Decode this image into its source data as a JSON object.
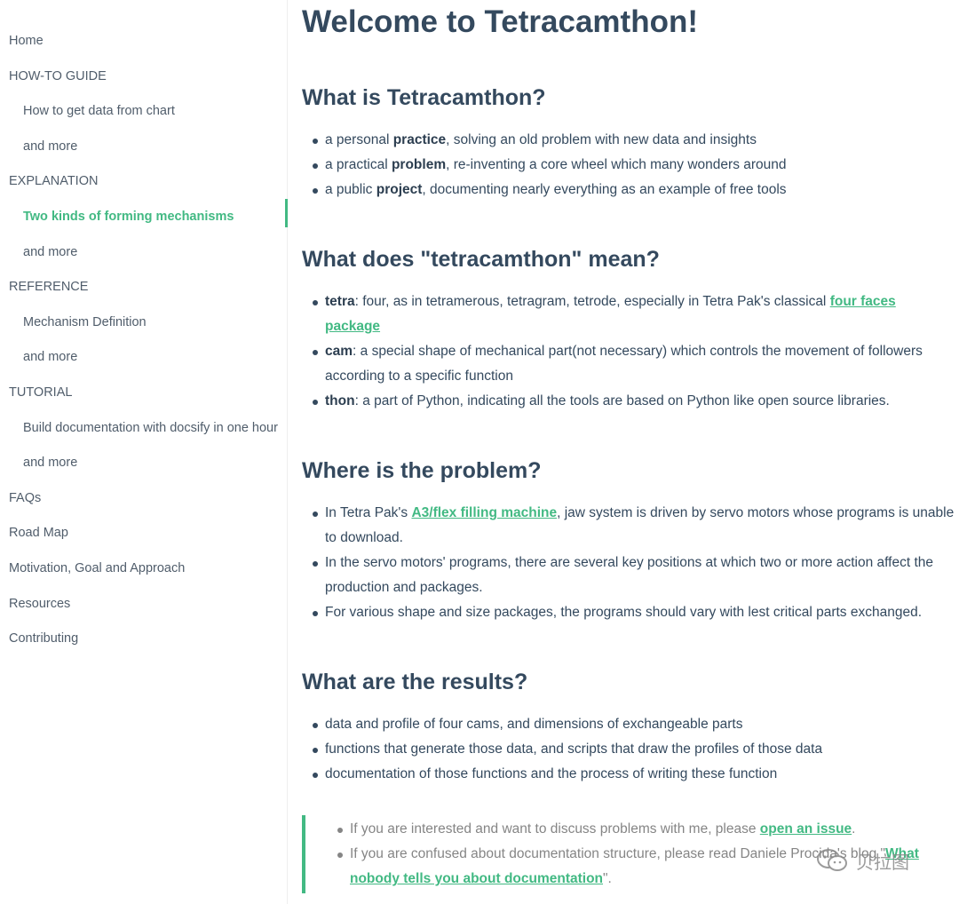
{
  "sidebar": {
    "items": [
      {
        "label": "Home",
        "level": 0,
        "active": false
      },
      {
        "label": "HOW-TO GUIDE",
        "level": 0,
        "active": false
      },
      {
        "label": "How to get data from chart",
        "level": 1,
        "active": false
      },
      {
        "label": "and more",
        "level": 1,
        "active": false
      },
      {
        "label": "EXPLANATION",
        "level": 0,
        "active": false
      },
      {
        "label": "Two kinds of forming mechanisms",
        "level": 1,
        "active": true
      },
      {
        "label": "and more",
        "level": 1,
        "active": false
      },
      {
        "label": "REFERENCE",
        "level": 0,
        "active": false
      },
      {
        "label": "Mechanism Definition",
        "level": 1,
        "active": false
      },
      {
        "label": "and more",
        "level": 1,
        "active": false
      },
      {
        "label": "TUTORIAL",
        "level": 0,
        "active": false
      },
      {
        "label": "Build documentation with docsify in one hour",
        "level": 1,
        "active": false
      },
      {
        "label": "and more",
        "level": 1,
        "active": false
      },
      {
        "label": "FAQs",
        "level": 0,
        "active": false
      },
      {
        "label": "Road Map",
        "level": 0,
        "active": false
      },
      {
        "label": "Motivation, Goal and Approach",
        "level": 0,
        "active": false
      },
      {
        "label": "Resources",
        "level": 0,
        "active": false
      },
      {
        "label": "Contributing",
        "level": 0,
        "active": false
      }
    ]
  },
  "main": {
    "title": "Welcome to Tetracamthon!",
    "sections": {
      "what": {
        "heading": "What is Tetracamthon?",
        "items": [
          {
            "pre": "a personal ",
            "bold": "practice",
            "post": ", solving an old problem with new data and insights"
          },
          {
            "pre": "a practical ",
            "bold": "problem",
            "post": ", re-inventing a core wheel which many wonders around"
          },
          {
            "pre": "a public ",
            "bold": "project",
            "post": ", documenting nearly everything as an example of free tools"
          }
        ]
      },
      "meaning": {
        "heading": "What does \"tetracamthon\" mean?",
        "tetra": {
          "bold": "tetra",
          "text": ": four, as in tetramerous, tetragram, tetrode, especially in Tetra Pak's classical ",
          "link": "four faces package"
        },
        "cam": {
          "bold": "cam",
          "text": ": a special shape of mechanical part(not necessary) which controls the movement of followers according to a specific function"
        },
        "thon": {
          "bold": "thon",
          "text": ": a part of Python, indicating all the tools are based on Python like open source libraries."
        }
      },
      "problem": {
        "heading": "Where is the problem?",
        "item1": {
          "pre": "In Tetra Pak's ",
          "link": "A3/flex filling machine",
          "post": ", jaw system is driven by servo motors whose programs is unable to download."
        },
        "item2": "In the servo motors' programs, there are several key positions at which two or more action affect the production and packages.",
        "item3": "For various shape and size packages, the programs should vary with lest critical parts exchanged."
      },
      "results": {
        "heading": "What are the results?",
        "items": [
          "data and profile of four cams, and dimensions of exchangeable parts",
          "functions that generate those data, and scripts that draw the profiles of those data",
          "documentation of those functions and the process of writing these function"
        ]
      }
    },
    "note": {
      "item1": {
        "pre": "If you are interested and want to discuss problems with me, please ",
        "link": "open an issue",
        "post": "."
      },
      "item2": {
        "pre": "If you are confused about documentation structure, please read Daniele Procida's blog \"",
        "link": "What nobody tells you about documentation",
        "post": "\"."
      }
    }
  },
  "watermark": {
    "text": "贝拉图",
    "icon": "wechat-icon"
  },
  "colors": {
    "accent": "#42b983",
    "text": "#34495e",
    "muted": "#858585"
  }
}
